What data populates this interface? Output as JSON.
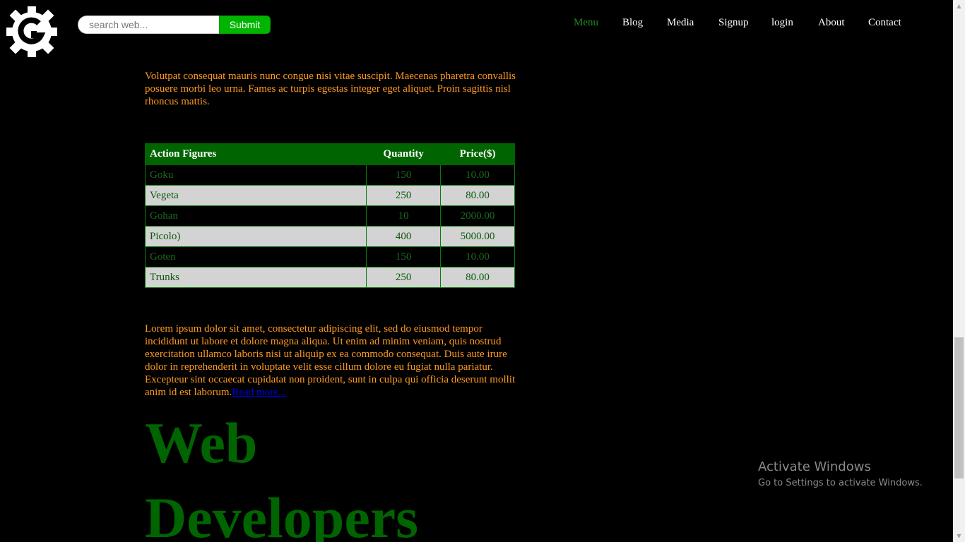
{
  "header": {
    "logo_icon": "gear-g-logo-icon",
    "search": {
      "placeholder": "search web...",
      "value": "",
      "submit_label": "Submit"
    },
    "nav": [
      {
        "label": "Menu",
        "active": true
      },
      {
        "label": "Blog"
      },
      {
        "label": "Media"
      },
      {
        "label": "Signup"
      },
      {
        "label": "login"
      },
      {
        "label": "About"
      },
      {
        "label": "Contact"
      }
    ]
  },
  "main": {
    "intro_text": "Volutpat consequat mauris nunc congue nisi vitae suscipit. Maecenas pharetra convallis posuere morbi leo urna. Fames ac turpis egestas integer eget aliquet. Proin sagittis nisl rhoncus mattis.",
    "table": {
      "headers": [
        "Action Figures",
        "Quantity",
        "Price($)"
      ],
      "rows": [
        [
          "Goku",
          "150",
          "10.00"
        ],
        [
          "Vegeta",
          "250",
          "80.00"
        ],
        [
          "Gohan",
          "10",
          "2000.00"
        ],
        [
          "Picolo)",
          "400",
          "5000.00"
        ],
        [
          "Goten",
          "150",
          "10.00"
        ],
        [
          "Trunks",
          "250",
          "80.00"
        ]
      ]
    },
    "lorem_text": "Lorem ipsum dolor sit amet, consectetur adipiscing elit, sed do eiusmod tempor incididunt ut labore et dolore magna aliqua. Ut enim ad minim veniam, quis nostrud exercitation ullamco laboris nisi ut aliquip ex ea commodo consequat. Duis aute irure dolor in reprehenderit in voluptate velit esse cillum dolore eu fugiat nulla pariatur. Excepteur sint occaecat cupidatat non proident, sunt in culpa qui officia deserunt mollit anim id est laborum.",
    "read_more_label": "Read more...",
    "big_heading": "Web Developers"
  },
  "watermark": {
    "line1": "Activate Windows",
    "line2": "Go to Settings to activate Windows."
  },
  "colors": {
    "background": "#000000",
    "text_orange": "#ff9a1f",
    "accent_green": "#006400",
    "submit_green": "#00b500",
    "nav_active": "#1e8a1e"
  }
}
